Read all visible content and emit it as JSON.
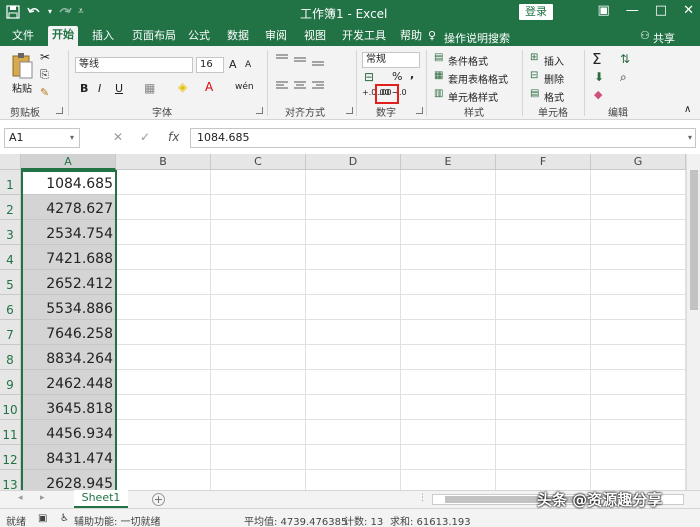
{
  "window": {
    "title": "工作簿1 - Excel",
    "login_label": "登录",
    "accent_color": "#217346"
  },
  "qat": {
    "save_icon": "save-icon",
    "undo_icon": "undo-icon",
    "redo_icon": "redo-icon",
    "customize_icon": "qat-dropdown-icon"
  },
  "window_controls": {
    "ribbon_display": "ribbon-display-icon",
    "minimize": "—",
    "maximize": "□",
    "close": "✕"
  },
  "tabs": [
    "文件",
    "开始",
    "插入",
    "页面布局",
    "公式",
    "数据",
    "审阅",
    "视图",
    "开发工具",
    "帮助"
  ],
  "active_tab": "开始",
  "tell_me": "操作说明搜索",
  "share": "共享",
  "ribbon": {
    "clipboard": {
      "paste": "粘贴",
      "label": "剪贴板"
    },
    "font": {
      "family": "等线",
      "size": "16",
      "bold": "B",
      "italic": "I",
      "underline": "U",
      "label": "字体",
      "grow": "A",
      "shrink": "A",
      "phonetic": "wén"
    },
    "alignment": {
      "label": "对齐方式"
    },
    "number": {
      "format": "常规",
      "percent": "%",
      "comma": ",",
      "increase_decimal": "+.0 .00",
      "decrease_decimal": ".00 →.0",
      "label": "数字"
    },
    "styles": {
      "conditional": "条件格式",
      "table": "套用表格格式",
      "cell": "单元格样式",
      "label": "样式"
    },
    "cells": {
      "insert": "插入",
      "delete": "删除",
      "format": "格式",
      "label": "单元格"
    },
    "editing": {
      "label": "编辑",
      "sum": "Σ"
    }
  },
  "formula_bar": {
    "name_box": "A1",
    "cancel": "✕",
    "enter": "✓",
    "fx": "fx",
    "content": "1084.685"
  },
  "sheet": {
    "columns": [
      "A",
      "B",
      "C",
      "D",
      "E",
      "F",
      "G"
    ],
    "rows": [
      "1",
      "2",
      "3",
      "4",
      "5",
      "6",
      "7",
      "8",
      "9",
      "10",
      "11",
      "12",
      "13"
    ],
    "column_a": [
      "1084.685",
      "4278.627",
      "2534.754",
      "7421.688",
      "2652.412",
      "5534.886",
      "7646.258",
      "8834.264",
      "2462.448",
      "3645.818",
      "4456.934",
      "8431.474",
      "2628.945"
    ]
  },
  "sheet_tabs": {
    "active": "Sheet1",
    "add": "+"
  },
  "status": {
    "ready": "就绪",
    "accessibility": "辅助功能: 一切就绪",
    "average": "平均值: 4739.476385",
    "count": "计数: 13",
    "sum": "求和: 61613.193",
    "watermark": "头条 @资源趣分享"
  }
}
